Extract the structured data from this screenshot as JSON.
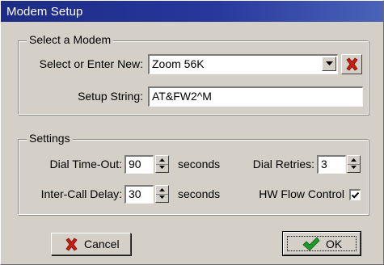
{
  "window": {
    "title": "Modem Setup"
  },
  "modem_group": {
    "legend": "Select a Modem",
    "select_label": "Select or Enter New:",
    "select_value": "Zoom 56K",
    "setup_label": "Setup String:",
    "setup_value": "AT&FW2^M"
  },
  "settings_group": {
    "legend": "Settings",
    "dial_timeout_label": "Dial Time-Out:",
    "dial_timeout_value": "90",
    "dial_timeout_unit": "seconds",
    "intercall_label": "Inter-Call Delay:",
    "intercall_value": "30",
    "intercall_unit": "seconds",
    "dial_retries_label": "Dial Retries:",
    "dial_retries_value": "3",
    "hw_flow_label": "HW Flow Control",
    "hw_flow_checked": true
  },
  "buttons": {
    "cancel_label": "Cancel",
    "ok_label": "OK"
  },
  "icons": {
    "delete": "red-x-icon",
    "cancel": "red-x-icon",
    "ok": "green-check-icon",
    "dropdown": "chevron-down-icon",
    "spin_up": "arrow-up-icon",
    "spin_down": "arrow-down-icon"
  },
  "colors": {
    "titlebar": "#1d2c86",
    "face": "#d4d0c8",
    "delete_red": "#c81e14",
    "ok_green": "#1f9a2a"
  }
}
